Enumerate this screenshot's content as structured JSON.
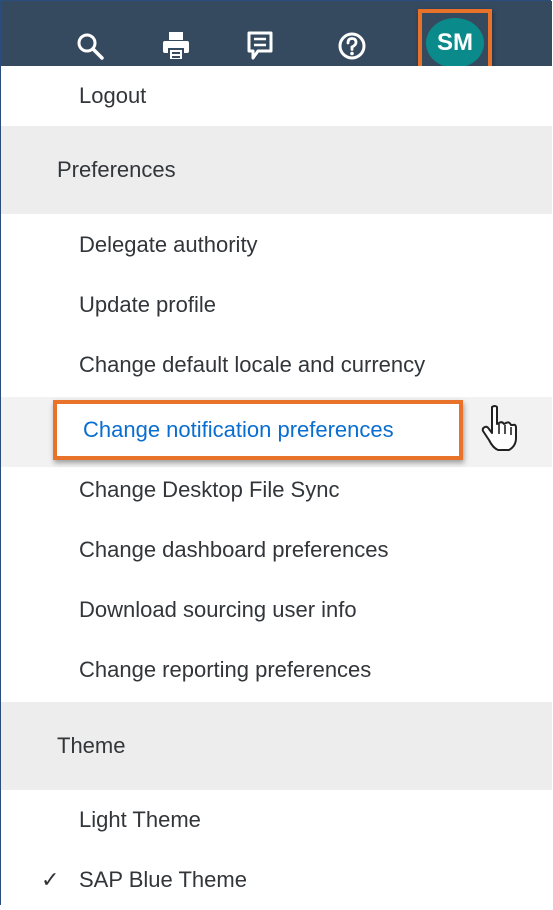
{
  "header": {
    "icons": [
      "search-icon",
      "print-icon",
      "feedback-icon",
      "help-icon"
    ],
    "avatar_initials": "SM"
  },
  "menu": {
    "logout": "Logout",
    "preferences_header": "Preferences",
    "preferences_items": [
      "Delegate authority",
      "Update profile",
      "Change default locale and currency",
      "Change notification preferences",
      "Change Desktop File Sync",
      "Change dashboard preferences",
      "Download sourcing user info",
      "Change reporting preferences"
    ],
    "theme_header": "Theme",
    "theme_items": [
      "Light Theme",
      "SAP Blue Theme"
    ],
    "selected_theme_mark": "✓"
  },
  "colors": {
    "topbar": "#354a5f",
    "accent_highlight": "#e8722a",
    "link_active": "#0a6ed1",
    "avatar": "#0a8a8a"
  }
}
